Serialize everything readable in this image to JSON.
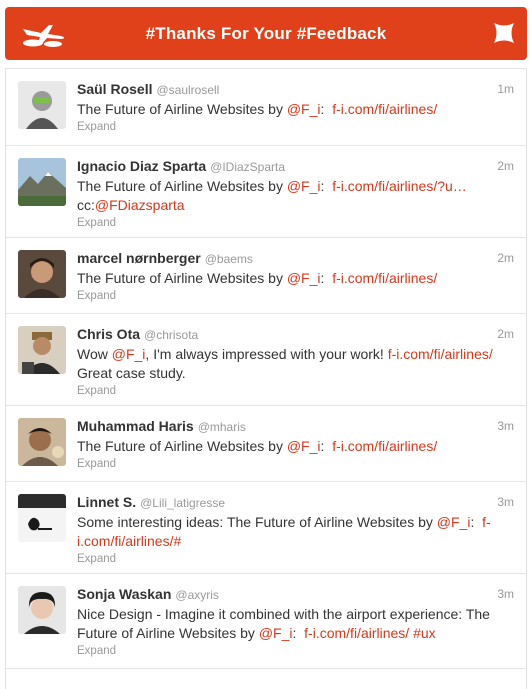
{
  "header": {
    "title": "#Thanks For Your #Feedback",
    "background": "#e0401a",
    "logo_icon": "airplane-cloud-icon",
    "settings_icon": "cross-shape-icon"
  },
  "colors": {
    "link": "#d4381c",
    "meta": "#999999",
    "text": "#333333"
  },
  "tweets": [
    {
      "name": "Saül Rosell",
      "handle": "@saulrosell",
      "time": "1m",
      "text": "The Future of Airline Websites by ",
      "mention": "@F_i",
      "sep": ":  ",
      "url": "f-i.com/fi/airlines/",
      "expand": "Expand"
    },
    {
      "name": "Ignacio Diaz Sparta",
      "handle": "@IDiazSparta",
      "time": "2m",
      "text": "The Future of Airline Websites by ",
      "mention": "@F_i",
      "sep": ":  ",
      "url": "f-i.com/fi/airlines/?u…",
      "cc": "cc:",
      "cc_mention": "@FDiazsparta",
      "expand": "Expand"
    },
    {
      "name": "marcel nørnberger",
      "handle": "@baems",
      "time": "2m",
      "text": "The Future of Airline Websites by ",
      "mention": "@F_i",
      "sep": ":  ",
      "url": "f-i.com/fi/airlines/",
      "expand": "Expand"
    },
    {
      "name": "Chris Ota",
      "handle": "@chrisota",
      "time": "2m",
      "pre": "Wow ",
      "mention": "@F_i",
      "text": ", I'm always impressed with your work! ",
      "url": "f-i.com/fi/airlines/",
      "post": "Great case study.",
      "expand": "Expand"
    },
    {
      "name": "Muhammad Haris",
      "handle": "@mharis",
      "time": "3m",
      "text": "The Future of Airline Websites by ",
      "mention": "@F_i",
      "sep": ":  ",
      "url": "f-i.com/fi/airlines/",
      "expand": "Expand"
    },
    {
      "name": "Linnet S.",
      "handle": "@Lili_latigresse",
      "time": "3m",
      "text": "Some interesting ideas: The Future of Airline Websites by ",
      "mention": "@F_i",
      "sep": ":  ",
      "url1": "f-",
      "url2": "i.com/fi/airlines/#",
      "expand": "Expand"
    },
    {
      "name": "Sonja Waskan",
      "handle": "@axyris",
      "time": "3m",
      "text1": "Nice Design - Imagine it combined with the airport experience: The",
      "text2": "Future of Airline Websites by ",
      "mention": "@F_i",
      "sep": ":  ",
      "url": "f-i.com/fi/airlines/",
      "hashtag": "#ux",
      "expand": "Expand"
    }
  ]
}
